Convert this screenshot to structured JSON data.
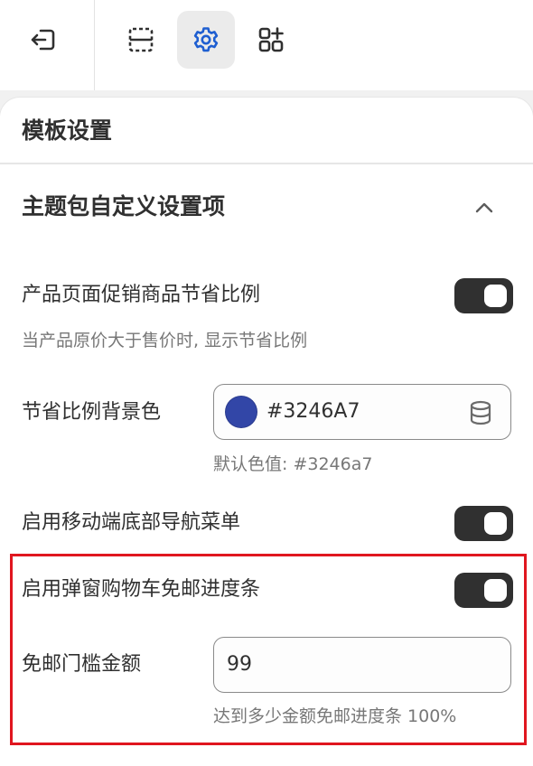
{
  "toolbar": {
    "items": [
      {
        "name": "exit",
        "icon": "exit-icon"
      },
      {
        "name": "sections",
        "icon": "sections-icon"
      },
      {
        "name": "theme-settings",
        "icon": "gear-icon",
        "active": true
      },
      {
        "name": "apps",
        "icon": "apps-add-icon"
      }
    ]
  },
  "panel": {
    "title": "模板设置"
  },
  "section": {
    "title": "主题包自定义设置项",
    "expanded": true
  },
  "settings": {
    "savings_toggle": {
      "label": "产品页面促销商品节省比例",
      "help": "当产品原价大于售价时, 显示节省比例",
      "on": true
    },
    "savings_bg_color": {
      "label": "节省比例背景色",
      "value": "#3246A7",
      "swatch_color": "#3246a7",
      "help": "默认色值: #3246a7"
    },
    "mobile_nav_toggle": {
      "label": "启用移动端底部导航菜单",
      "on": true
    },
    "cart_progress_toggle": {
      "label": "启用弹窗购物车免邮进度条",
      "on": true
    },
    "free_shipping_threshold": {
      "label": "免邮门槛金额",
      "value": "99",
      "help": "达到多少金额免邮进度条 100%"
    }
  },
  "colors": {
    "accent": "#1f5fd1",
    "highlight_border": "#e0161f",
    "toggle_on": "#303030"
  }
}
